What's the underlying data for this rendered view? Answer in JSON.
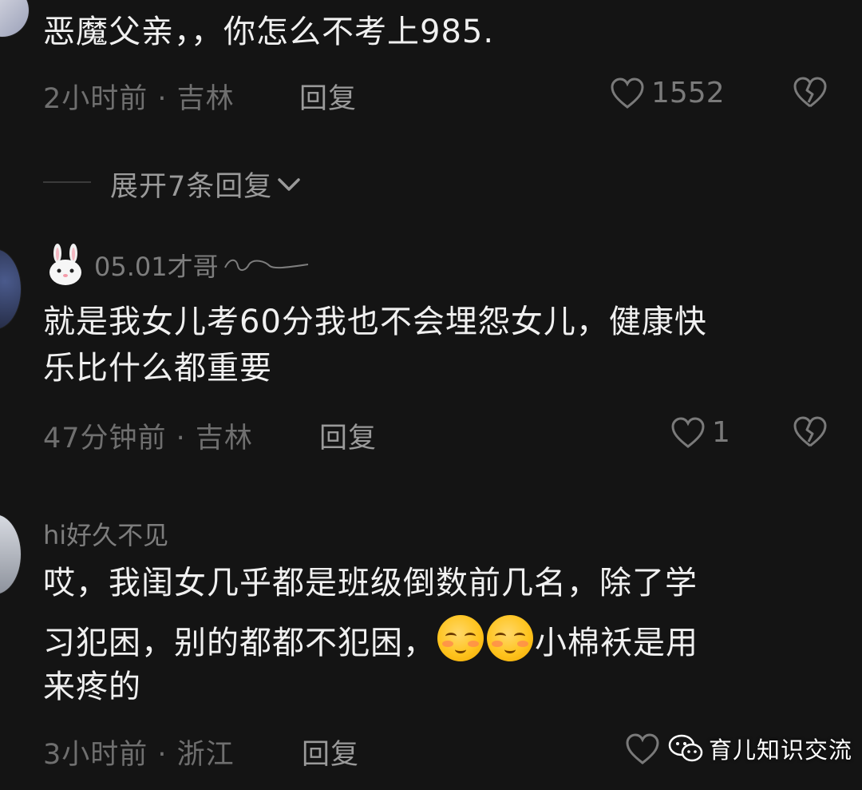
{
  "comments": [
    {
      "text": "恶魔父亲，，你怎么不考上985.",
      "time_location": "2小时前 · 吉林",
      "reply_label": "回复",
      "likes": "1552"
    },
    {
      "username": "05.01才哥",
      "text_line1": "就是我女儿考60分我也不会埋怨女儿，健康快",
      "text_line2": "乐比什么都重要",
      "time_location": "47分钟前 · 吉林",
      "reply_label": "回复",
      "likes": "1"
    },
    {
      "username": "hi好久不见",
      "text_line1": "哎，我闺女几乎都是班级倒数前几名，除了学",
      "text_line2a": "习犯困，别的都都不犯困，",
      "text_line2b": "小棉袄是用",
      "text_line3": "来疼的",
      "time_location": "3小时前 · 浙江",
      "reply_label": "回复"
    }
  ],
  "expand_replies_label": "展开7条回复",
  "watermark_text": "育儿知识交流",
  "icons": {
    "heart": "heart-icon",
    "dislike": "broken-heart-icon",
    "chevron": "chevron-down-icon",
    "wechat": "wechat-icon"
  },
  "colors": {
    "background": "#141414",
    "text": "#f0f0f0",
    "meta": "#6f6f6f"
  }
}
